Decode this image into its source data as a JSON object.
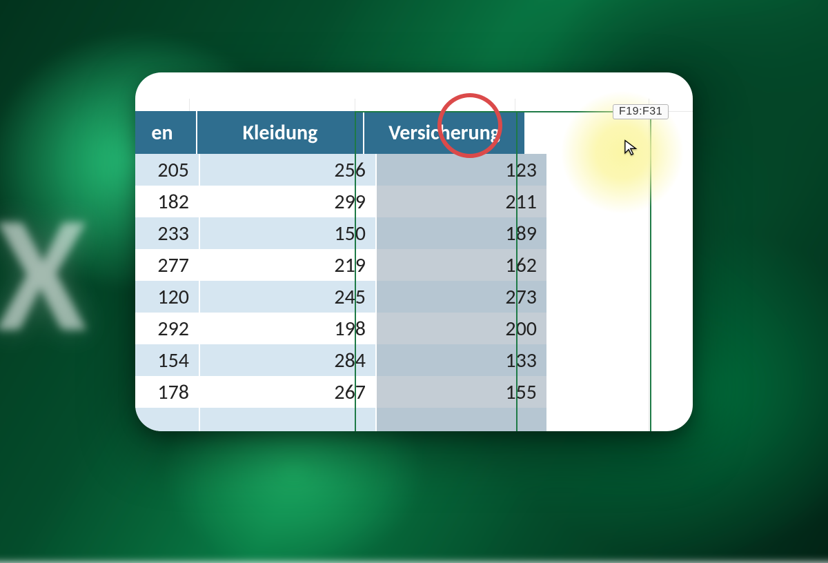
{
  "range_tooltip": "F19:F31",
  "table": {
    "headers": {
      "col1_fragment": "en",
      "col2": "Kleidung",
      "col3": "Versicherung"
    },
    "rows": [
      {
        "c1": "205",
        "c2": "256",
        "c3": "123"
      },
      {
        "c1": "182",
        "c2": "299",
        "c3": "211"
      },
      {
        "c1": "233",
        "c2": "150",
        "c3": "189"
      },
      {
        "c1": "277",
        "c2": "219",
        "c3": "162"
      },
      {
        "c1": "120",
        "c2": "245",
        "c3": "273"
      },
      {
        "c1": "292",
        "c2": "198",
        "c3": "200"
      },
      {
        "c1": "154",
        "c2": "284",
        "c3": "133"
      },
      {
        "c1": "178",
        "c2": "267",
        "c3": "155"
      }
    ]
  },
  "colors": {
    "header_bg": "#2f6e8f",
    "row_alt": "#d6e6f1",
    "selection_border": "#1e7a46",
    "annotation_red": "#db4a4a",
    "highlight_yellow": "#fbf6a6"
  }
}
